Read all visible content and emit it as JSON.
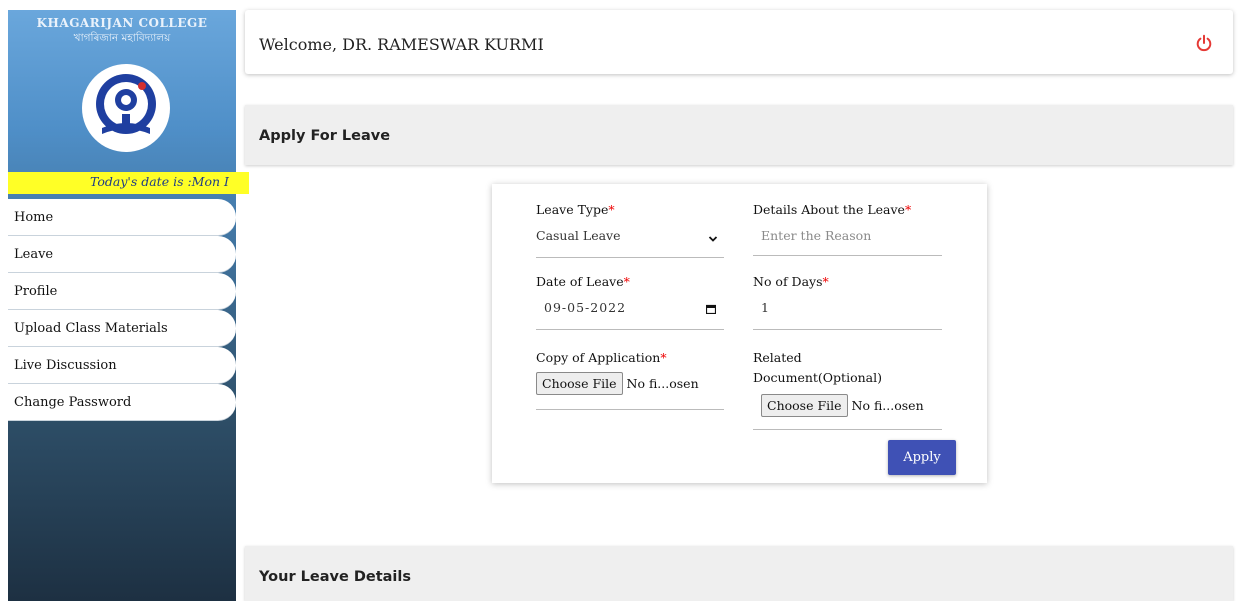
{
  "sidebar": {
    "college_name": "KHAGARIJAN COLLEGE",
    "college_name_local": "খাগৰিজান মহাবিদ্যালয়",
    "date_text": "Today's date is :Mon I",
    "items": [
      {
        "label": "Home"
      },
      {
        "label": "Leave"
      },
      {
        "label": "Profile"
      },
      {
        "label": "Upload Class Materials"
      },
      {
        "label": "Live Discussion"
      },
      {
        "label": "Change Password"
      }
    ]
  },
  "header": {
    "welcome": "Welcome, DR. RAMESWAR KURMI",
    "power_icon": "power-icon",
    "accent": "#e53935"
  },
  "apply_section": {
    "title": "Apply For Leave"
  },
  "form": {
    "leave_type_label": "Leave Type",
    "leave_type_value": "Casual Leave",
    "details_label": "Details About the Leave",
    "details_placeholder": "Enter the Reason",
    "date_label": "Date of Leave",
    "date_value": "09-05-2022",
    "days_label": "No of Days",
    "days_value": "1",
    "copy_label": "Copy of Application",
    "related_label_1": "Related",
    "related_label_2": "Document(Optional)",
    "choose_file": "Choose File",
    "no_file": "No fi...osen",
    "required_mark": "*",
    "apply_button": "Apply",
    "apply_color": "#3f51b5"
  },
  "details_section": {
    "title": "Your Leave Details"
  }
}
